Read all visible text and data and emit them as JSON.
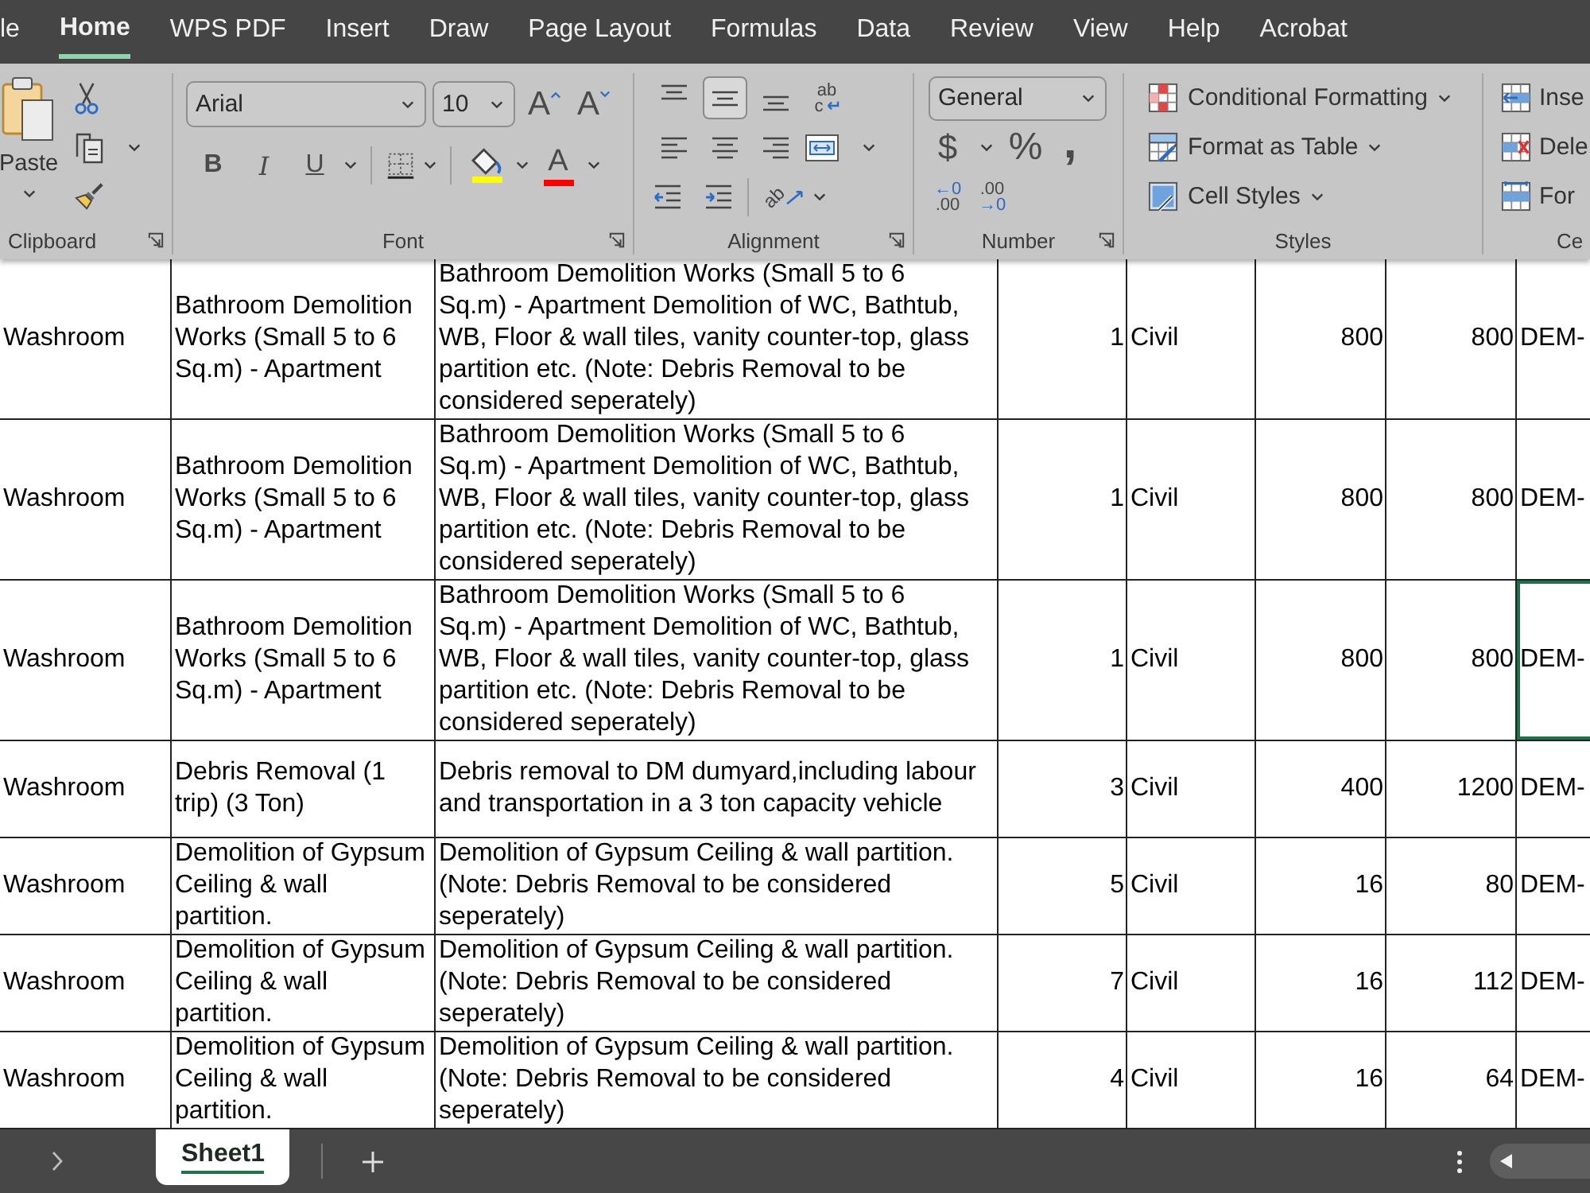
{
  "ribbon_tabs": [
    {
      "label": "le",
      "selected": false
    },
    {
      "label": "Home",
      "selected": true
    },
    {
      "label": "WPS PDF",
      "selected": false
    },
    {
      "label": "Insert",
      "selected": false
    },
    {
      "label": "Draw",
      "selected": false
    },
    {
      "label": "Page Layout",
      "selected": false
    },
    {
      "label": "Formulas",
      "selected": false
    },
    {
      "label": "Data",
      "selected": false
    },
    {
      "label": "Review",
      "selected": false
    },
    {
      "label": "View",
      "selected": false
    },
    {
      "label": "Help",
      "selected": false
    },
    {
      "label": "Acrobat",
      "selected": false
    }
  ],
  "clipboard": {
    "label": "Clipboard",
    "paste": "Paste"
  },
  "font": {
    "label": "Font",
    "font_name": "Arial",
    "font_size": "10",
    "size_buttons": [
      {
        "kind": "grow",
        "glyph": "A"
      },
      {
        "kind": "shrink",
        "glyph": "A"
      }
    ],
    "style_buttons": [
      {
        "kind": "bold",
        "glyph": "B"
      },
      {
        "kind": "italic",
        "glyph": "I"
      },
      {
        "kind": "underline",
        "glyph": "U"
      }
    ],
    "fill_color": {
      "color": "#ffff00"
    },
    "font_color": {
      "glyph": "A",
      "color": "#ff0000"
    }
  },
  "alignment": {
    "label": "Alignment",
    "vertical": [
      {
        "kind": "top",
        "selected": false
      },
      {
        "kind": "middle",
        "selected": true
      },
      {
        "kind": "bottom",
        "selected": false
      }
    ],
    "wrap_text": [
      "ab",
      "c"
    ],
    "horizontal": [
      {
        "kind": "left",
        "selected": false
      },
      {
        "kind": "center",
        "selected": false
      },
      {
        "kind": "right",
        "selected": false
      }
    ],
    "orientation": "ab"
  },
  "number": {
    "label": "Number",
    "format": "General",
    "buttons": [
      {
        "kind": "currency",
        "glyph": "$"
      },
      {
        "kind": "percent",
        "glyph": "%"
      },
      {
        "kind": "comma",
        "glyph": ","
      }
    ],
    "decimal_buttons": [
      {
        "kind": "decrease",
        "lines": [
          "←0",
          ".00"
        ]
      },
      {
        "kind": "increase",
        "lines": [
          ".00",
          "→0"
        ]
      }
    ]
  },
  "styles": {
    "label": "Styles",
    "items": [
      "Conditional Formatting",
      "Format as Table",
      "Cell Styles"
    ]
  },
  "cells": {
    "label": "Ce",
    "items": [
      "Inse",
      "Dele",
      "For"
    ]
  },
  "sheet": {
    "rows": [
      {
        "cells": [
          {
            "text": "Washroom",
            "selected": false
          },
          {
            "text": "Bathroom Demolition\nWorks (Small 5 to 6\nSq.m) - Apartment",
            "selected": false
          },
          {
            "text": "Bathroom Demolition Works (Small 5 to 6\nSq.m) - Apartment Demolition of WC, Bathtub,\nWB, Floor & wall tiles, vanity counter-top, glass\npartition etc. (Note: Debris Removal to be\nconsidered seperately)",
            "selected": false
          },
          {
            "text": "1",
            "selected": false
          },
          {
            "text": "Civil",
            "selected": false
          },
          {
            "text": "800",
            "selected": false
          },
          {
            "text": "800",
            "selected": false
          },
          {
            "text": "DEM-",
            "selected": false
          }
        ]
      },
      {
        "cells": [
          {
            "text": "Washroom",
            "selected": false
          },
          {
            "text": "Bathroom Demolition\nWorks (Small 5 to 6\nSq.m) - Apartment",
            "selected": false
          },
          {
            "text": "Bathroom Demolition Works (Small 5 to 6\nSq.m) - Apartment Demolition of WC, Bathtub,\nWB, Floor & wall tiles, vanity counter-top, glass\npartition etc. (Note: Debris Removal to be\nconsidered seperately)",
            "selected": false
          },
          {
            "text": "1",
            "selected": false
          },
          {
            "text": "Civil",
            "selected": false
          },
          {
            "text": "800",
            "selected": false
          },
          {
            "text": "800",
            "selected": false
          },
          {
            "text": "DEM-",
            "selected": false
          }
        ]
      },
      {
        "cells": [
          {
            "text": "Washroom",
            "selected": false
          },
          {
            "text": "Bathroom Demolition\nWorks (Small 5 to 6\nSq.m) - Apartment",
            "selected": false
          },
          {
            "text": "Bathroom Demolition Works (Small 5 to 6\nSq.m) - Apartment Demolition of WC, Bathtub,\nWB, Floor & wall tiles, vanity counter-top, glass\npartition etc. (Note: Debris Removal to be\nconsidered seperately)",
            "selected": false
          },
          {
            "text": "1",
            "selected": false
          },
          {
            "text": "Civil",
            "selected": false
          },
          {
            "text": "800",
            "selected": false
          },
          {
            "text": "800",
            "selected": false
          },
          {
            "text": "DEM-",
            "selected": true
          }
        ]
      },
      {
        "cells": [
          {
            "text": "Washroom",
            "selected": false
          },
          {
            "text": "Debris Removal (1\ntrip) (3 Ton)",
            "selected": false
          },
          {
            "text": "Debris removal to DM dumyard,including labour\nand transportation in a 3 ton capacity vehicle",
            "selected": false
          },
          {
            "text": "3",
            "selected": false
          },
          {
            "text": "Civil",
            "selected": false
          },
          {
            "text": "400",
            "selected": false
          },
          {
            "text": "1200",
            "selected": false
          },
          {
            "text": "DEM-",
            "selected": false
          }
        ]
      },
      {
        "cells": [
          {
            "text": "Washroom",
            "selected": false
          },
          {
            "text": "Demolition of Gypsum\nCeiling & wall\npartition.",
            "selected": false
          },
          {
            "text": "Demolition of Gypsum Ceiling & wall partition.\n(Note: Debris Removal to be considered\nseperately)",
            "selected": false
          },
          {
            "text": "5",
            "selected": false
          },
          {
            "text": "Civil",
            "selected": false
          },
          {
            "text": "16",
            "selected": false
          },
          {
            "text": "80",
            "selected": false
          },
          {
            "text": "DEM-",
            "selected": false
          }
        ]
      },
      {
        "cells": [
          {
            "text": "Washroom",
            "selected": false
          },
          {
            "text": "Demolition of Gypsum\nCeiling & wall\npartition.",
            "selected": false
          },
          {
            "text": "Demolition of Gypsum Ceiling & wall partition.\n(Note: Debris Removal to be considered\nseperately)",
            "selected": false
          },
          {
            "text": "7",
            "selected": false
          },
          {
            "text": "Civil",
            "selected": false
          },
          {
            "text": "16",
            "selected": false
          },
          {
            "text": "112",
            "selected": false
          },
          {
            "text": "DEM-",
            "selected": false
          }
        ]
      },
      {
        "cells": [
          {
            "text": "Washroom",
            "selected": false
          },
          {
            "text": "Demolition of Gypsum\nCeiling & wall\npartition.",
            "selected": false
          },
          {
            "text": "Demolition of Gypsum Ceiling & wall partition.\n(Note: Debris Removal to be considered\nseperately)",
            "selected": false
          },
          {
            "text": "4",
            "selected": false
          },
          {
            "text": "Civil",
            "selected": false
          },
          {
            "text": "16",
            "selected": false
          },
          {
            "text": "64",
            "selected": false
          },
          {
            "text": "DEM-",
            "selected": false
          }
        ]
      }
    ]
  },
  "sheet_tabs": [
    {
      "label": "Sheet1",
      "selected": true
    }
  ]
}
